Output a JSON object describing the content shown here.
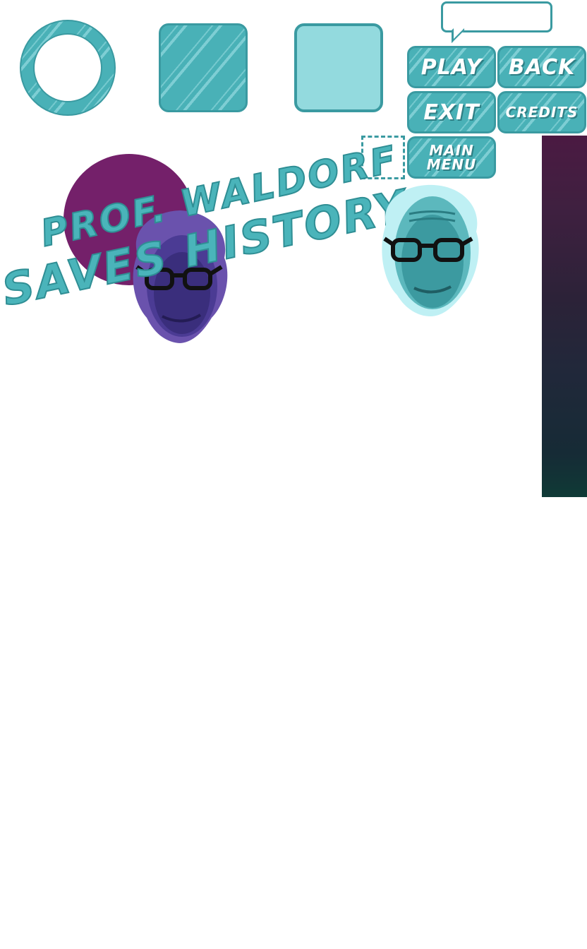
{
  "buttons": {
    "play": "PLAY",
    "back": "BACK",
    "exit": "EXIT",
    "credits": "CREDITS",
    "main_menu_line1": "MAIN",
    "main_menu_line2": "MENU"
  },
  "title": {
    "line1": "PROF. WALDORF",
    "line2": "SAVES HISTORY"
  },
  "colors": {
    "teal": "#49b1b7",
    "teal_dark": "#3a9aa1",
    "teal_light": "#93dade",
    "title_circle": "#74206a",
    "portrait_purple": "#5b3f9c",
    "portrait_cyan": "#3c9aa0",
    "gradient_top": "#4b1a42",
    "gradient_bottom": "#0f3a36"
  },
  "icons": {
    "ring": "ring-icon",
    "frame": "selection-frame-icon",
    "bubble": "speech-bubble-icon"
  }
}
